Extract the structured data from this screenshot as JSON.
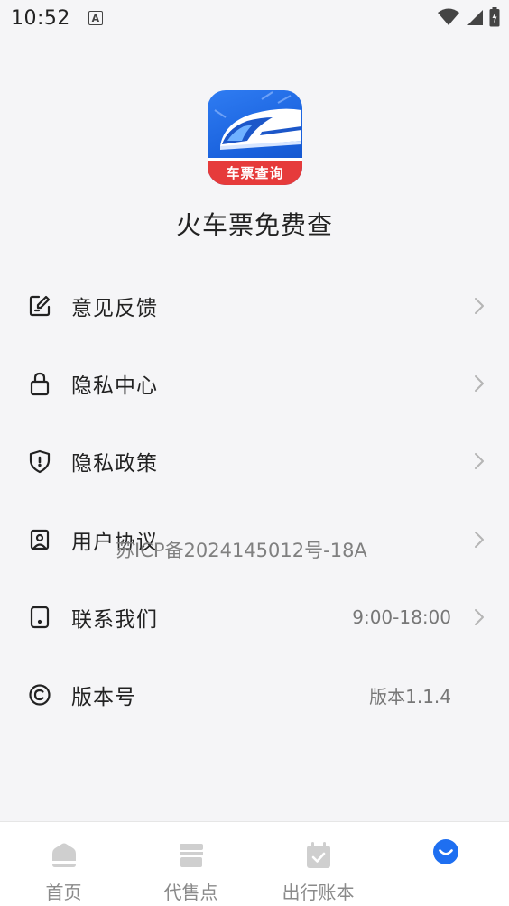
{
  "status_bar": {
    "time": "10:52",
    "notification_icon": "A"
  },
  "app": {
    "logo_banner_text": "车票查询",
    "name": "火车票免费查"
  },
  "menu": {
    "items": [
      {
        "label": "意见反馈",
        "value": "",
        "icon": "feedback-edit-icon"
      },
      {
        "label": "隐私中心",
        "value": "",
        "icon": "lock-icon"
      },
      {
        "label": "隐私政策",
        "value": "",
        "icon": "shield-icon"
      },
      {
        "label": "用户协议",
        "value": "",
        "icon": "user-agreement-icon"
      },
      {
        "label": "联系我们",
        "value": "9:00-18:00",
        "icon": "phone-icon"
      },
      {
        "label": "版本号",
        "value": "版本1.1.4",
        "icon": "copyright-icon"
      }
    ]
  },
  "watermark": "苏ICP备2024145012号-18A",
  "tabs": [
    {
      "label": "首页",
      "icon": "home-icon",
      "active": false
    },
    {
      "label": "代售点",
      "icon": "store-icon",
      "active": false
    },
    {
      "label": "出行账本",
      "icon": "calendar-check-icon",
      "active": false
    },
    {
      "label": "",
      "icon": "profile-smile-icon",
      "active": true
    }
  ],
  "colors": {
    "accent": "#1e6ff1",
    "banner_red": "#e63b3b",
    "background": "#f5f5f7",
    "inactive_tab": "#cfcfcf"
  }
}
